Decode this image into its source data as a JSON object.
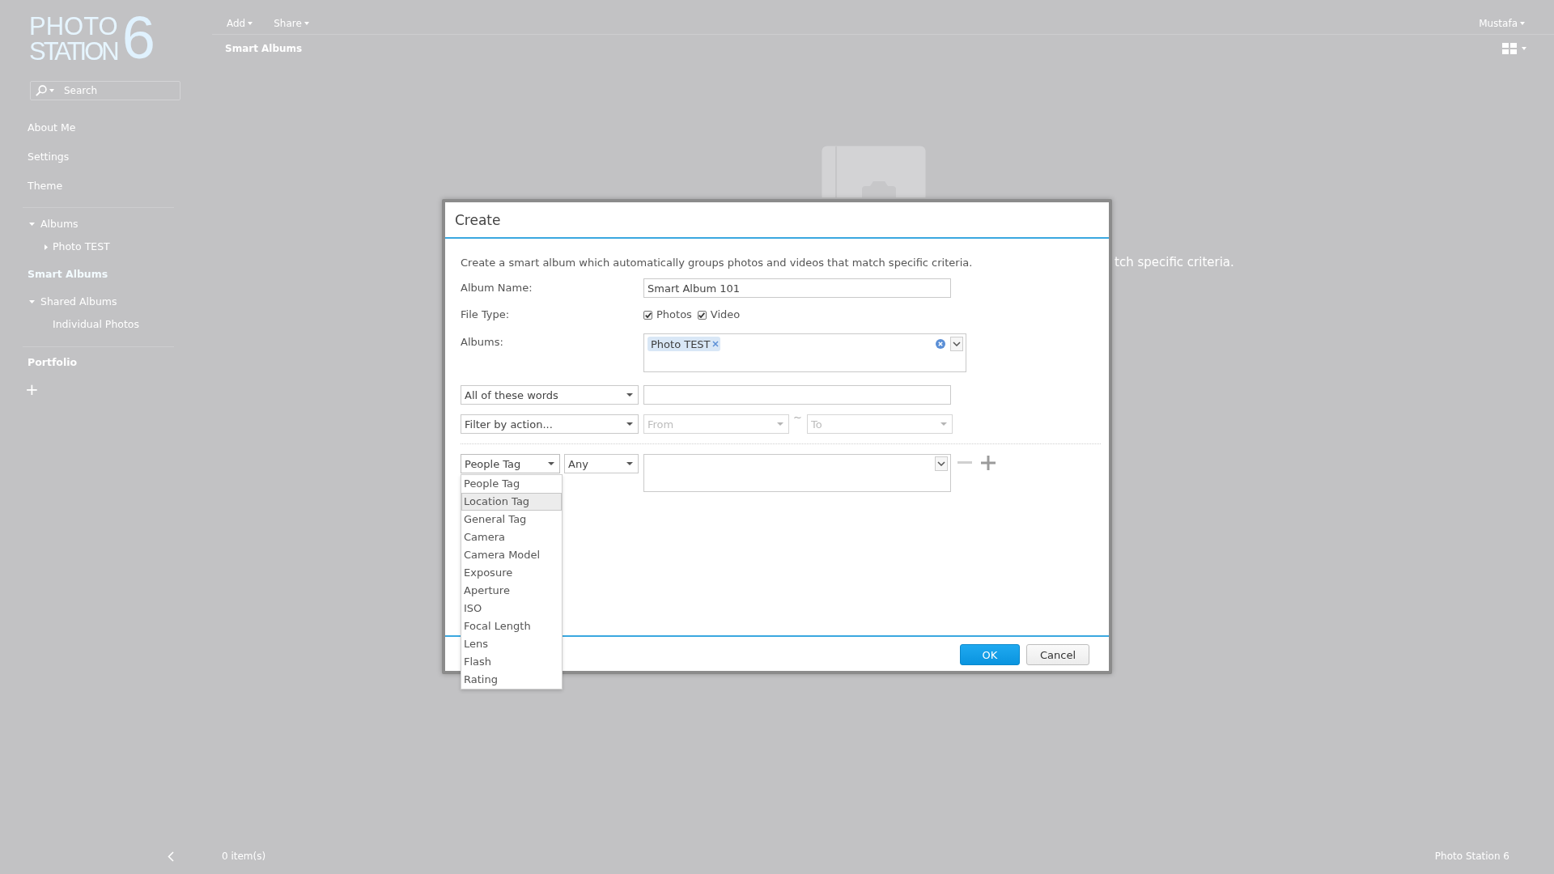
{
  "logo": {
    "line1": "PHOTO",
    "line2": "STATION",
    "version": "6"
  },
  "sidebar": {
    "search": {
      "placeholder": "Search"
    },
    "menu": [
      {
        "label": "About Me"
      },
      {
        "label": "Settings"
      },
      {
        "label": "Theme"
      }
    ],
    "tree": [
      {
        "label": "Albums",
        "expanded": true,
        "selected": false,
        "children": [
          {
            "label": "Photo TEST",
            "expanded": false,
            "selected": false
          }
        ]
      },
      {
        "label": "Smart Albums",
        "selected": true
      },
      {
        "label": "Shared Albums",
        "expanded": true,
        "selected": false,
        "children": [
          {
            "label": "Individual Photos",
            "selected": false
          }
        ]
      }
    ],
    "portfolio": "Portfolio",
    "add_button": "+"
  },
  "toolbar": {
    "menus": [
      "Add",
      "Share"
    ],
    "user": "Mustafa"
  },
  "breadcrumb": "Smart Albums",
  "background": {
    "message_visible": "tch specific criteria."
  },
  "dialog": {
    "title": "Create",
    "description": "Create a smart album which automatically groups photos and videos that match specific criteria.",
    "album_name": {
      "label": "Album Name:",
      "value": "Smart Album 101"
    },
    "file_type": {
      "label": "File Type:",
      "options": [
        {
          "label": "Photos",
          "checked": true
        },
        {
          "label": "Video",
          "checked": true
        }
      ]
    },
    "albums": {
      "label": "Albums:",
      "chips": [
        "Photo TEST"
      ]
    },
    "keyword_filter": {
      "mode": "All of these words"
    },
    "action_filter": {
      "action": "Filter by action...",
      "from": {
        "placeholder": "From",
        "disabled": true
      },
      "separator": "~",
      "to": {
        "placeholder": "To",
        "disabled": true
      }
    },
    "condition": {
      "field": {
        "value": "People Tag",
        "expanded": true,
        "options": [
          {
            "label": "People Tag",
            "highlighted": false
          },
          {
            "label": "Location Tag",
            "highlighted": true
          },
          {
            "label": "General Tag",
            "highlighted": false
          },
          {
            "label": "Camera",
            "highlighted": false
          },
          {
            "label": "Camera Model",
            "highlighted": false
          },
          {
            "label": "Exposure",
            "highlighted": false
          },
          {
            "label": "Aperture",
            "highlighted": false
          },
          {
            "label": "ISO",
            "highlighted": false
          },
          {
            "label": "Focal Length",
            "highlighted": false
          },
          {
            "label": "Lens",
            "highlighted": false
          },
          {
            "label": "Flash",
            "highlighted": false
          },
          {
            "label": "Rating",
            "highlighted": false
          }
        ]
      },
      "operator": {
        "value": "Any"
      }
    },
    "buttons": [
      {
        "label": "OK",
        "kind": "confirm"
      },
      {
        "label": "Cancel",
        "kind": "cancel"
      }
    ]
  },
  "status_bar": {
    "count": "0 item(s)",
    "app_name": "Photo Station 6"
  }
}
